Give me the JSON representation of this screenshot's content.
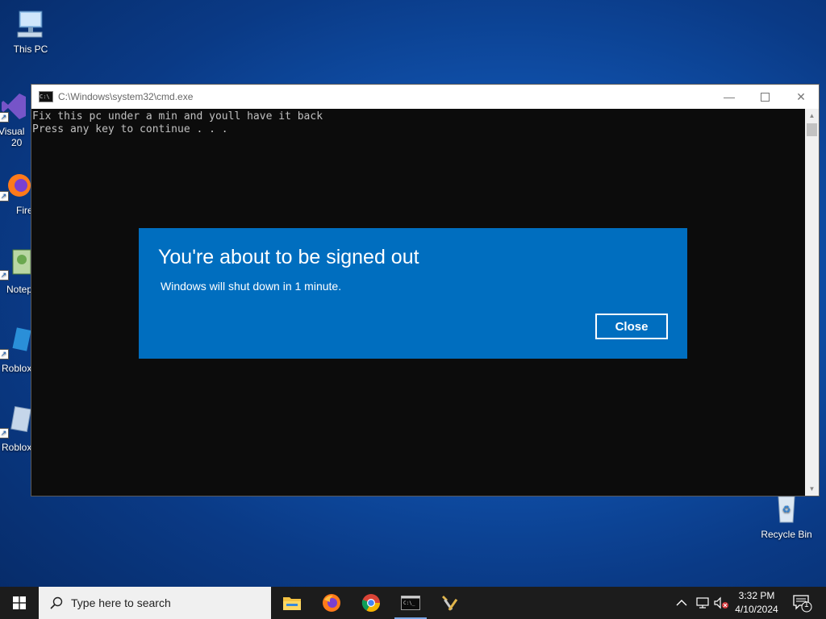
{
  "desktop": {
    "icons": [
      {
        "label": "This PC"
      },
      {
        "label": "Visual"
      },
      {
        "label": "20"
      },
      {
        "label": "Fire"
      },
      {
        "label": "Notep"
      },
      {
        "label": "Roblox"
      },
      {
        "label": "Roblox"
      },
      {
        "label": "Recycle Bin"
      }
    ]
  },
  "cmd": {
    "title": "C:\\Windows\\system32\\cmd.exe",
    "output": "Fix this pc under a min and youll have it back\nPress any key to continue . . ."
  },
  "dialog": {
    "title": "You're about to be signed out",
    "message": "Windows will shut down in 1 minute.",
    "close_label": "Close"
  },
  "taskbar": {
    "search_placeholder": "Type here to search",
    "time": "3:32 PM",
    "date": "4/10/2024",
    "notification_count": "1",
    "apps": [
      "file-explorer",
      "firefox",
      "chrome",
      "command-prompt",
      "tools"
    ]
  },
  "colors": {
    "dialog_bg": "#006ebf",
    "taskbar_bg": "#1c1c1c",
    "desktop_blue": "#0f4fa8"
  }
}
